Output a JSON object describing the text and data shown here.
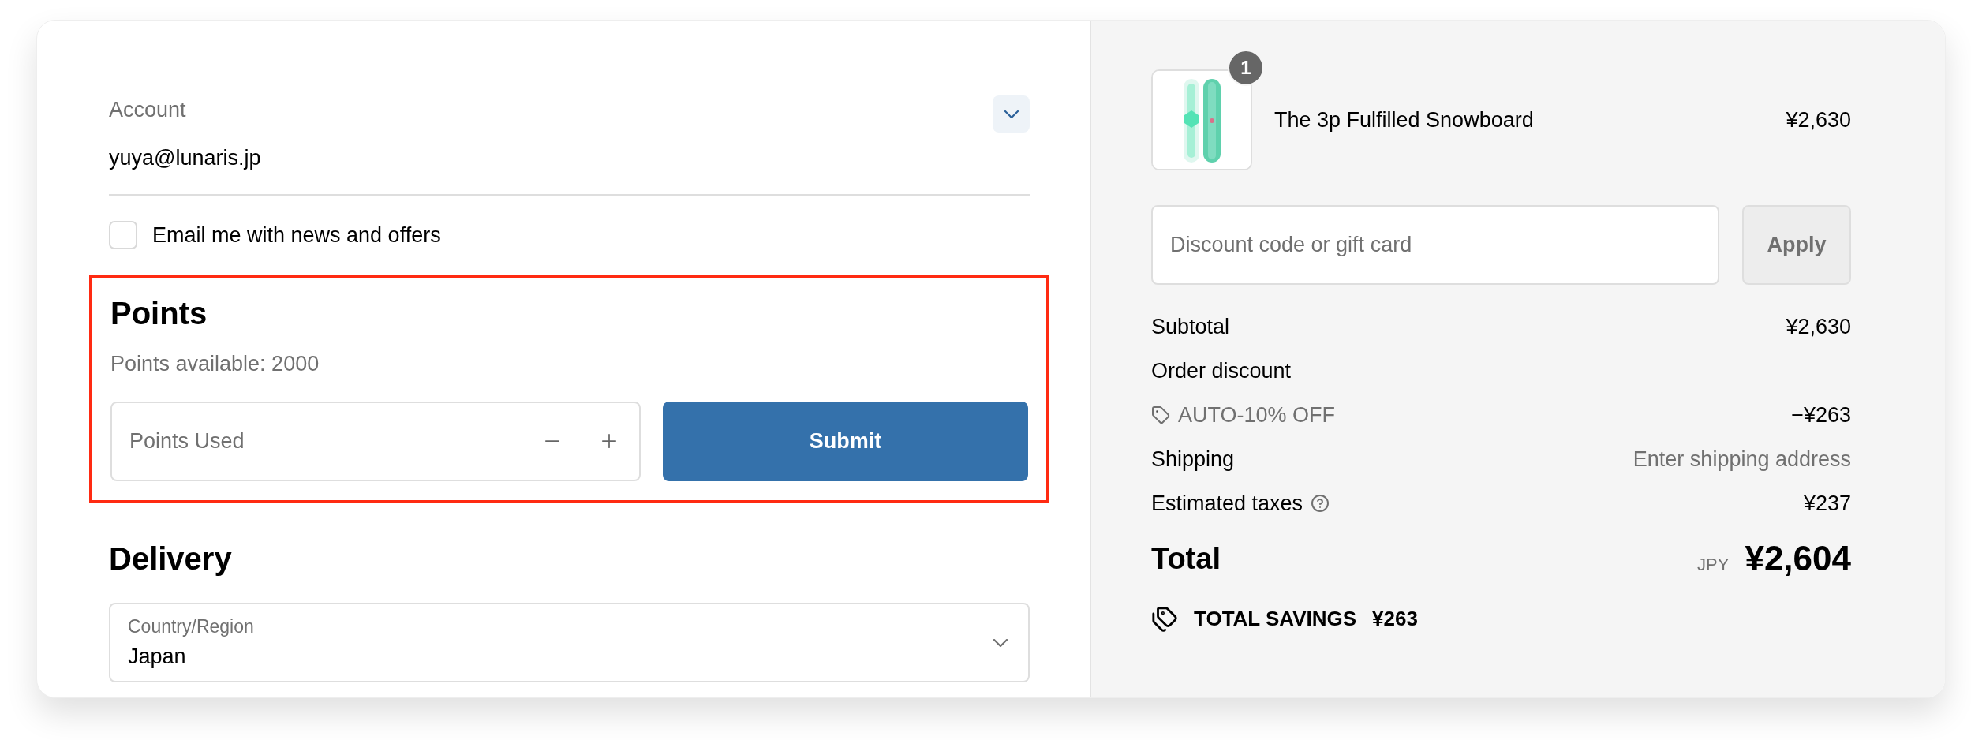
{
  "account": {
    "label": "Account",
    "email": "yuya@lunaris.jp"
  },
  "newsletter": {
    "label": "Email me with news and offers",
    "checked": false
  },
  "points": {
    "title": "Points",
    "available": "Points available: 2000",
    "field": {
      "placeholder": "Points Used"
    },
    "submit": "Submit",
    "highlighted": true
  },
  "delivery": {
    "title": "Delivery",
    "country": {
      "label": "Country/Region",
      "value": "Japan"
    }
  },
  "cart": {
    "items": [
      {
        "kind": "picture",
        "quantity": "1",
        "name": "The 3p Fulfilled Snowboard",
        "price": "¥2,630"
      }
    ],
    "discount": {
      "placeholder": "Discount code or gift card",
      "button": "Apply"
    },
    "summary": [
      {
        "kind": "plain",
        "label": "Subtotal",
        "value": "¥2,630"
      },
      {
        "kind": "plain",
        "label": "Order discount"
      },
      {
        "kind": "code",
        "label": "AUTO-10% OFF",
        "value": "−¥263"
      },
      {
        "kind": "muted",
        "label": "Shipping",
        "value": "Enter shipping address"
      },
      {
        "kind": "help",
        "label": "Estimated taxes",
        "value": "¥237"
      }
    ],
    "total": {
      "label": "Total",
      "currency": "JPY",
      "value": "¥2,604"
    },
    "savings": {
      "label": "TOTAL SAVINGS",
      "value": "¥263"
    }
  }
}
